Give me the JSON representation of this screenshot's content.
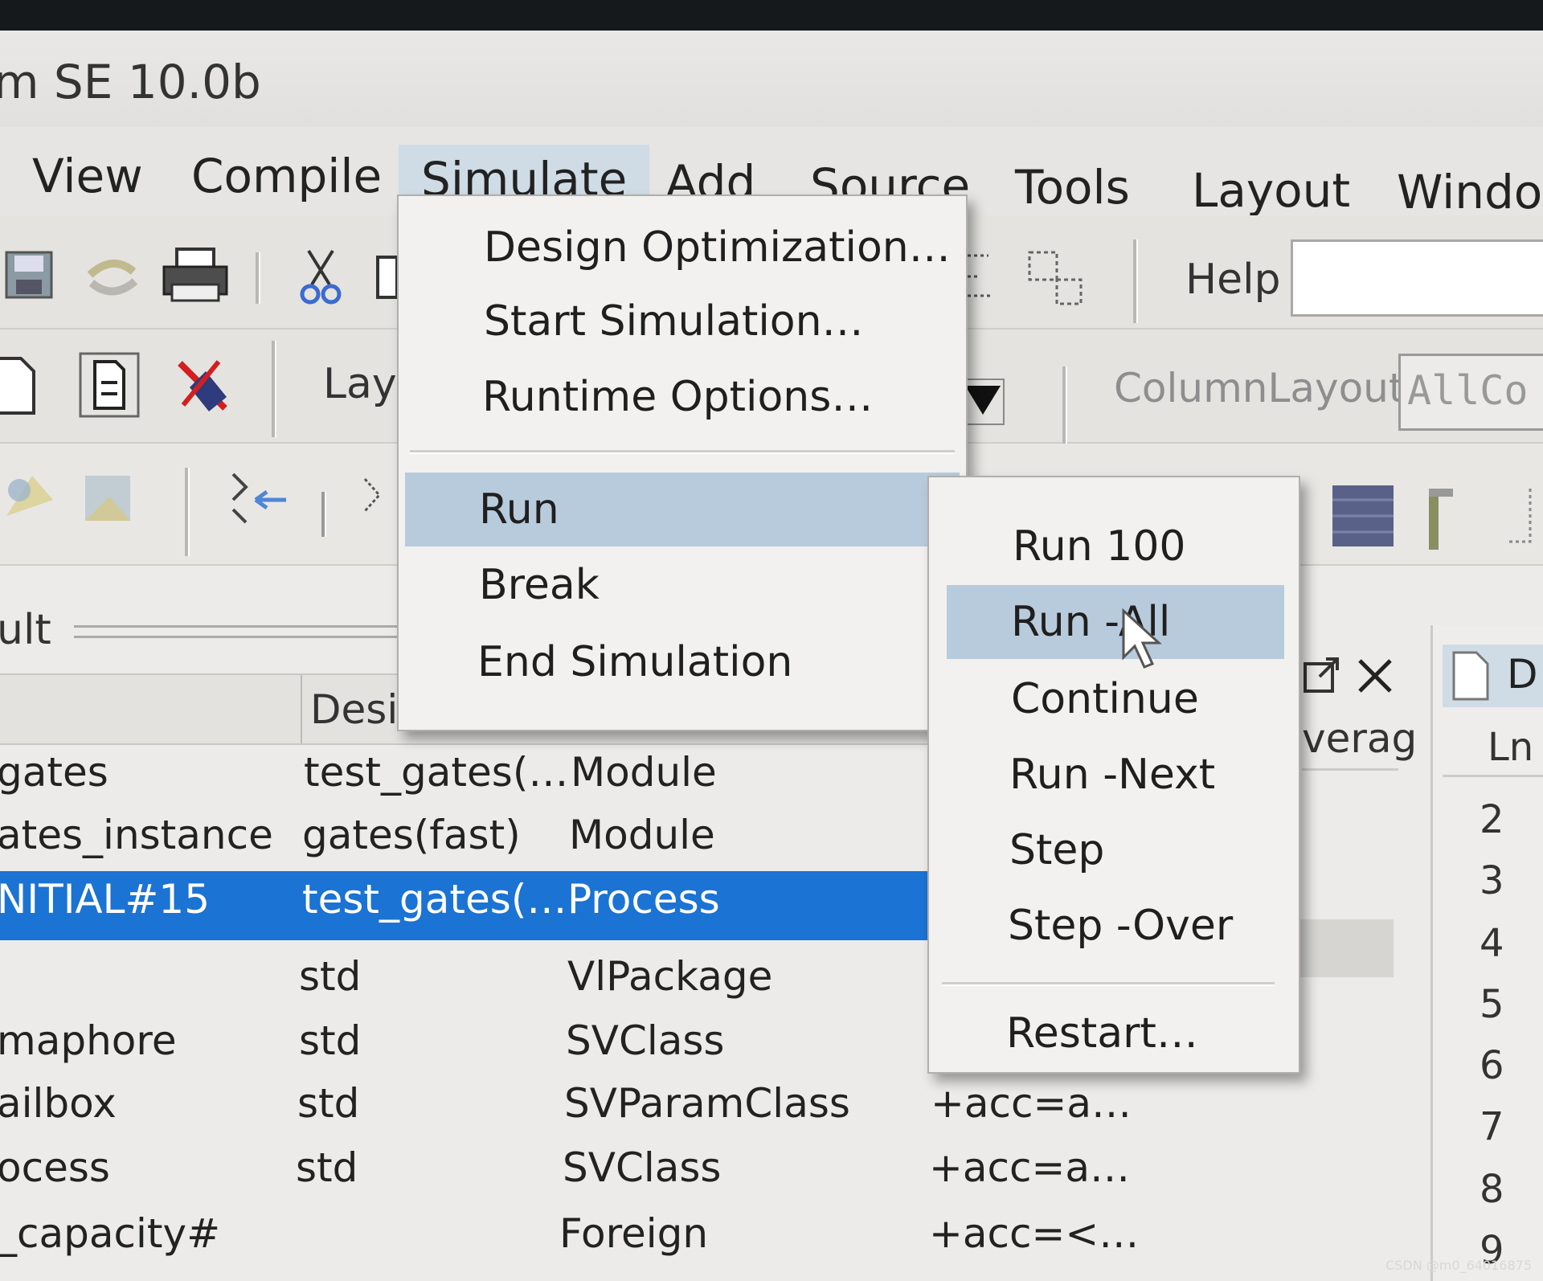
{
  "window": {
    "title": "m SE 10.0b"
  },
  "menubar": {
    "items": [
      "View",
      "Compile",
      "Simulate",
      "Add",
      "Source",
      "Tools",
      "Layout",
      "Windo"
    ],
    "active": "Simulate"
  },
  "toolbar": {
    "help_label": "Help",
    "layout_label": "Lay",
    "column_layout_label": "ColumnLayout",
    "column_layout_value": "AllCo",
    "default_label": "ult"
  },
  "panel": {
    "design_header": "Desi",
    "rows": [
      {
        "name": "gates",
        "design_unit": "test_gates(…",
        "type": "Module",
        "extra": ""
      },
      {
        "name": "ates_instance",
        "design_unit": "gates(fast)",
        "type": "Module",
        "extra": ""
      },
      {
        "name": "NITIAL#15",
        "design_unit": "test_gates(…",
        "type": "Process",
        "extra": ""
      },
      {
        "name": "",
        "design_unit": "std",
        "type": "VlPackage",
        "extra": ""
      },
      {
        "name": "maphore",
        "design_unit": "std",
        "type": "SVClass",
        "extra": ""
      },
      {
        "name": "ailbox",
        "design_unit": "std",
        "type": "SVParamClass",
        "extra": "+acc=a…"
      },
      {
        "name": "ocess",
        "design_unit": "std",
        "type": "SVClass",
        "extra": "+acc=a…"
      },
      {
        "name": "_capacity#",
        "design_unit": "",
        "type": "Foreign",
        "extra": "+acc=<…"
      }
    ],
    "coverage_header": "verag"
  },
  "simulate_menu": {
    "items": [
      {
        "label": "Design Optimization…",
        "mnemonic": "D"
      },
      {
        "label": "Start Simulation…",
        "mnemonic": "S"
      },
      {
        "label": "Runtime Options…",
        "mnemonic": "O"
      },
      {
        "label": "Run",
        "mnemonic": "R",
        "submenu": true
      },
      {
        "label": "Break",
        "mnemonic": "B"
      },
      {
        "label": "End Simulation",
        "mnemonic": "E"
      }
    ]
  },
  "run_submenu": {
    "items": [
      {
        "label": "Run 100"
      },
      {
        "label": "Run -All"
      },
      {
        "label": "Continue"
      },
      {
        "label": "Run -Next"
      },
      {
        "label": "Step"
      },
      {
        "label": "Step -Over"
      },
      {
        "label": "Restart…"
      }
    ]
  },
  "source_pane": {
    "header": "Ln",
    "header_tab": "D",
    "line_numbers": [
      "2",
      "3",
      "4",
      "5",
      "6",
      "7",
      "8",
      "9"
    ]
  },
  "watermark": "CSDN @m0_64016875",
  "colors": {
    "selection": "#1b73d3",
    "menu_highlight": "#b8cbdc",
    "menubar_active": "#cfdce5"
  }
}
